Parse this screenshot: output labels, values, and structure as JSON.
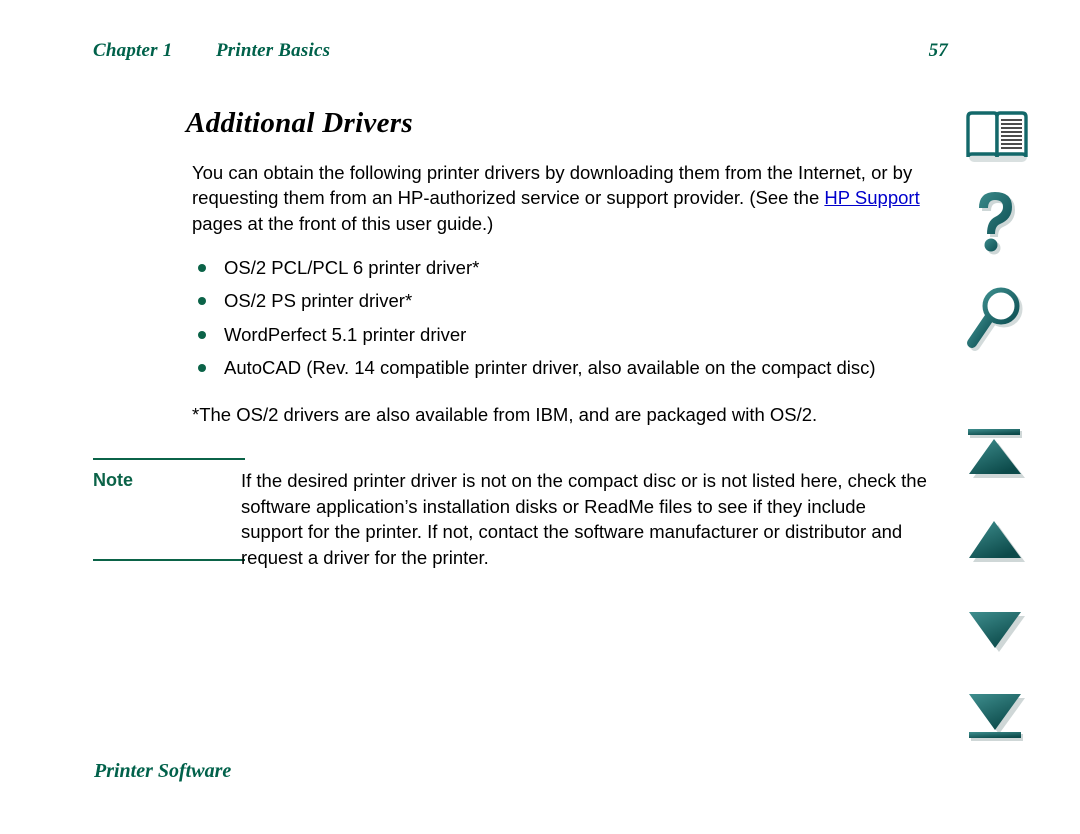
{
  "header": {
    "chapter": "Chapter 1",
    "section": "Printer Basics",
    "page_number": "57"
  },
  "title": "Additional Drivers",
  "intro": {
    "text_before_link": "You can obtain the following printer drivers by downloading them from the Internet, or by requesting them from an HP-authorized service or support provider. (See the ",
    "link_text": "HP Support",
    "text_after_link": " pages at the front of this user guide.)"
  },
  "bullets": [
    "OS/2 PCL/PCL 6 printer driver*",
    "OS/2 PS printer driver*",
    "WordPerfect 5.1 printer driver",
    "AutoCAD (Rev. 14 compatible printer driver, also available on the compact disc)"
  ],
  "footnote": "*The OS/2 drivers are also available from IBM, and are packaged with OS/2.",
  "note": {
    "label": "Note",
    "body": "If the desired printer driver is not on the compact disc or is not listed here, check the software application’s installation disks or ReadMe files to see if they include support for the printer. If not, contact the software manufacturer or distributor and request a driver for the printer."
  },
  "footer": "Printer Software",
  "sidebar": {
    "items": [
      {
        "icon": "open-book-icon",
        "name": "table-of-contents"
      },
      {
        "icon": "question-mark-icon",
        "name": "help"
      },
      {
        "icon": "magnifier-icon",
        "name": "search"
      },
      {
        "icon": "first-page-icon",
        "name": "go-to-first-page"
      },
      {
        "icon": "previous-page-icon",
        "name": "go-to-previous-page"
      },
      {
        "icon": "next-page-icon",
        "name": "go-to-next-page"
      },
      {
        "icon": "last-page-icon",
        "name": "go-to-last-page"
      }
    ]
  },
  "colors": {
    "green": "#00614a",
    "note_green": "#0b6348",
    "link_blue": "#0000cc",
    "icon_teal": "#1d6b6b",
    "icon_teal_dark": "#0d5050",
    "text_black": "#000000",
    "page_background": "#ffffff"
  }
}
